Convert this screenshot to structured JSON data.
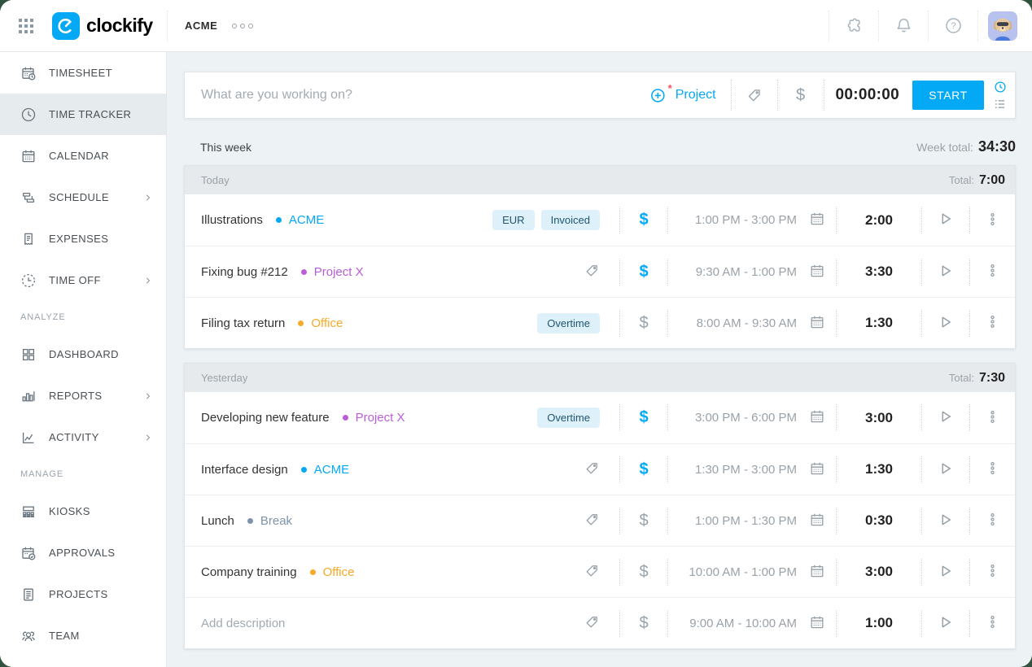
{
  "app": {
    "brand": "clockify",
    "workspace": "ACME"
  },
  "colors": {
    "accent_blue": "#03a9f4",
    "main_background": "#edf2f5",
    "group_header_background": "#e6eaed",
    "pill_background": "#def0fa",
    "pill_text": "#20566f",
    "project_acme": "#03a9f4",
    "project_x": "#bb5dd8",
    "project_office": "#f7a928",
    "project_break": "#7e93ab",
    "asterisk_red": "#ff4f5e"
  },
  "icons": {
    "header": [
      "apps-grid-icon",
      "clockify-logo-icon",
      "puzzle-icon",
      "bell-icon",
      "help-icon",
      "avatar"
    ],
    "tracker": [
      "plus-circle-icon",
      "tag-icon",
      "dollar-icon",
      "timer-mode-clock-icon",
      "manual-mode-list-icon"
    ],
    "row": [
      "tag-icon",
      "dollar-icon",
      "calendar-icon",
      "play-icon",
      "kebab-menu-icon"
    ]
  },
  "sidebar": {
    "sections": [
      {
        "label": "",
        "items": [
          {
            "id": "timesheet",
            "label": "TIMESHEET",
            "icon": "timesheet",
            "active": false,
            "chevron": false
          },
          {
            "id": "time-tracker",
            "label": "TIME TRACKER",
            "icon": "clock",
            "active": true,
            "chevron": false
          },
          {
            "id": "calendar",
            "label": "CALENDAR",
            "icon": "calendar",
            "active": false,
            "chevron": false
          },
          {
            "id": "schedule",
            "label": "SCHEDULE",
            "icon": "schedule",
            "active": false,
            "chevron": true
          },
          {
            "id": "expenses",
            "label": "EXPENSES",
            "icon": "receipt",
            "active": false,
            "chevron": false
          },
          {
            "id": "time-off",
            "label": "TIME OFF",
            "icon": "clockdash",
            "active": false,
            "chevron": true
          }
        ]
      },
      {
        "label": "ANALYZE",
        "items": [
          {
            "id": "dashboard",
            "label": "DASHBOARD",
            "icon": "dashboard",
            "active": false,
            "chevron": false
          },
          {
            "id": "reports",
            "label": "REPORTS",
            "icon": "barchart",
            "active": false,
            "chevron": true
          },
          {
            "id": "activity",
            "label": "ACTIVITY",
            "icon": "linechart",
            "active": false,
            "chevron": true
          }
        ]
      },
      {
        "label": "MANAGE",
        "items": [
          {
            "id": "kiosks",
            "label": "KIOSKS",
            "icon": "kiosk",
            "active": false,
            "chevron": false
          },
          {
            "id": "approvals",
            "label": "APPROVALS",
            "icon": "approval",
            "active": false,
            "chevron": false
          },
          {
            "id": "projects",
            "label": "PROJECTS",
            "icon": "document",
            "active": false,
            "chevron": false
          },
          {
            "id": "team",
            "label": "TEAM",
            "icon": "team",
            "active": false,
            "chevron": false
          }
        ]
      }
    ]
  },
  "tracker": {
    "placeholder": "What are you working on?",
    "project_button": "Project",
    "timer": "00:00:00",
    "start_button": "START"
  },
  "week": {
    "label": "This week",
    "total_label": "Week total:",
    "total": "34:30"
  },
  "groups": [
    {
      "label": "Today",
      "total_label": "Total:",
      "total": "7:00",
      "entries": [
        {
          "description": "Illustrations",
          "placeholder": false,
          "project": "ACME",
          "project_color": "#03a9f4",
          "tags": [
            "EUR",
            "Invoiced"
          ],
          "billable": true,
          "time_range": "1:00 PM - 3:00 PM",
          "duration": "2:00"
        },
        {
          "description": "Fixing bug #212",
          "placeholder": false,
          "project": "Project X",
          "project_color": "#bb5dd8",
          "tags": [],
          "billable": true,
          "time_range": "9:30 AM - 1:00 PM",
          "duration": "3:30"
        },
        {
          "description": "Filing tax return",
          "placeholder": false,
          "project": "Office",
          "project_color": "#f7a928",
          "tags": [
            "Overtime"
          ],
          "billable": false,
          "time_range": "8:00 AM - 9:30 AM",
          "duration": "1:30"
        }
      ]
    },
    {
      "label": "Yesterday",
      "total_label": "Total:",
      "total": "7:30",
      "entries": [
        {
          "description": "Developing new feature",
          "placeholder": false,
          "project": "Project X",
          "project_color": "#bb5dd8",
          "tags": [
            "Overtime"
          ],
          "billable": true,
          "time_range": "3:00 PM - 6:00 PM",
          "duration": "3:00"
        },
        {
          "description": "Interface design",
          "placeholder": false,
          "project": "ACME",
          "project_color": "#03a9f4",
          "tags": [],
          "billable": true,
          "time_range": "1:30 PM - 3:00 PM",
          "duration": "1:30"
        },
        {
          "description": "Lunch",
          "placeholder": false,
          "project": "Break",
          "project_color": "#7e93ab",
          "tags": [],
          "billable": false,
          "time_range": "1:00 PM - 1:30 PM",
          "duration": "0:30"
        },
        {
          "description": "Company training",
          "placeholder": false,
          "project": "Office",
          "project_color": "#f7a928",
          "tags": [],
          "billable": false,
          "time_range": "10:00 AM - 1:00 PM",
          "duration": "3:00"
        },
        {
          "description": "Add description",
          "placeholder": true,
          "project": null,
          "project_color": null,
          "tags": [],
          "billable": false,
          "time_range": "9:00 AM - 10:00 AM",
          "duration": "1:00"
        }
      ]
    }
  ]
}
